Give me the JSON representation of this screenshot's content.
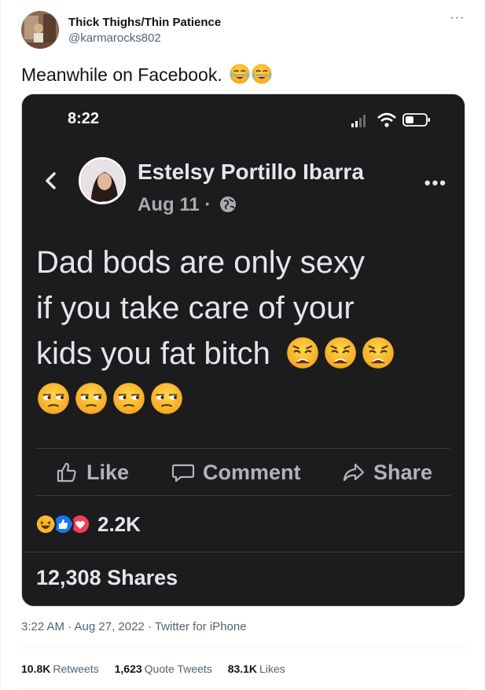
{
  "tweet": {
    "display_name": "Thick Thighs/Thin Patience",
    "handle": "@karmarocks802",
    "text": "Meanwhile on Facebook.",
    "text_emojis": [
      "face-with-tears-of-joy",
      "face-with-tears-of-joy"
    ],
    "timestamp": "3:22 AM · Aug 27, 2022 · Twitter for iPhone",
    "stats": {
      "retweets_count": "10.8K",
      "retweets_label": "Retweets",
      "quotes_count": "1,623",
      "quotes_label": "Quote Tweets",
      "likes_count": "83.1K",
      "likes_label": "Likes"
    }
  },
  "screenshot": {
    "status_time": "8:22",
    "fb_post": {
      "author": "Estelsy Portillo Ibarra",
      "date": "Aug 11 ·",
      "body_line1": "Dad bods are only sexy",
      "body_line2": "if you take care of your",
      "body_line3": "kids you fat bitch",
      "body_emojis_line3": [
        "weary-face",
        "weary-face",
        "weary-face"
      ],
      "body_emojis_line4": [
        "unamused-face",
        "unamused-face",
        "unamused-face",
        "unamused-face"
      ],
      "actions": {
        "like": "Like",
        "comment": "Comment",
        "share": "Share"
      },
      "reaction_types": [
        "haha",
        "like",
        "love"
      ],
      "reaction_count": "2.2K",
      "shares": "12,308 Shares"
    }
  },
  "colors": {
    "twitter_text": "#0f1419",
    "twitter_secondary": "#536471",
    "fb_dark_bg": "#1c1c1e",
    "fb_text": "#e4e6eb",
    "fb_secondary": "#b0b3b8",
    "fb_like_blue": "#1877f2",
    "fb_love_red": "#f33e58"
  }
}
